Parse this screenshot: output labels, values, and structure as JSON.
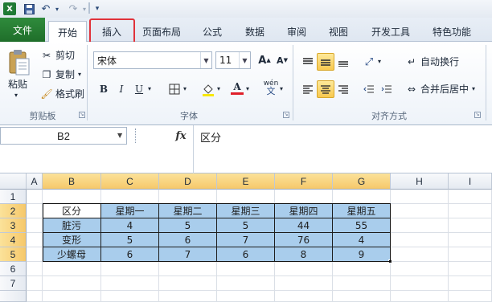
{
  "qat": {
    "app_icon": "excel-icon",
    "save_icon": "save-icon",
    "undo_icon": "undo-icon",
    "redo_icon": "redo-icon",
    "customize_icon": "chevron-down-icon"
  },
  "tabs": [
    {
      "label": "文件"
    },
    {
      "label": "开始"
    },
    {
      "label": "插入"
    },
    {
      "label": "页面布局"
    },
    {
      "label": "公式"
    },
    {
      "label": "数据"
    },
    {
      "label": "审阅"
    },
    {
      "label": "视图"
    },
    {
      "label": "开发工具"
    },
    {
      "label": "特色功能"
    }
  ],
  "ribbon": {
    "clipboard": {
      "paste": "粘贴",
      "cut": "剪切",
      "copy": "复制",
      "format_painter": "格式刷",
      "group_label": "剪贴板"
    },
    "font": {
      "font_name": "宋体",
      "font_size": "11",
      "bold": "B",
      "italic": "I",
      "underline": "U",
      "grow": "A",
      "shrink": "A",
      "font_color_letter": "A",
      "phonetic": "wén",
      "group_label": "字体"
    },
    "alignment": {
      "wrap_text": "自动换行",
      "merge_center": "合并后居中",
      "group_label": "对齐方式"
    }
  },
  "formula_bar": {
    "name_box": "B2",
    "fx": "fx",
    "content": "区分"
  },
  "sheet": {
    "columns": [
      "A",
      "B",
      "C",
      "D",
      "E",
      "F",
      "G",
      "H",
      "I"
    ],
    "rows": [
      "1",
      "2",
      "3",
      "4",
      "5",
      "6",
      "7"
    ],
    "table": [
      [
        "区分",
        "星期一",
        "星期二",
        "星期三",
        "星期四",
        "星期五"
      ],
      [
        "脏污",
        "4",
        "5",
        "5",
        "44",
        "55"
      ],
      [
        "变形",
        "5",
        "6",
        "7",
        "76",
        "4"
      ],
      [
        "少螺母",
        "6",
        "7",
        "6",
        "8",
        "9"
      ]
    ]
  },
  "colors": {
    "file_tab": "#1f6e2a",
    "table_fill": "#a9cdec",
    "highlight": "#e0323a",
    "selected_header": "#f6c86a"
  }
}
